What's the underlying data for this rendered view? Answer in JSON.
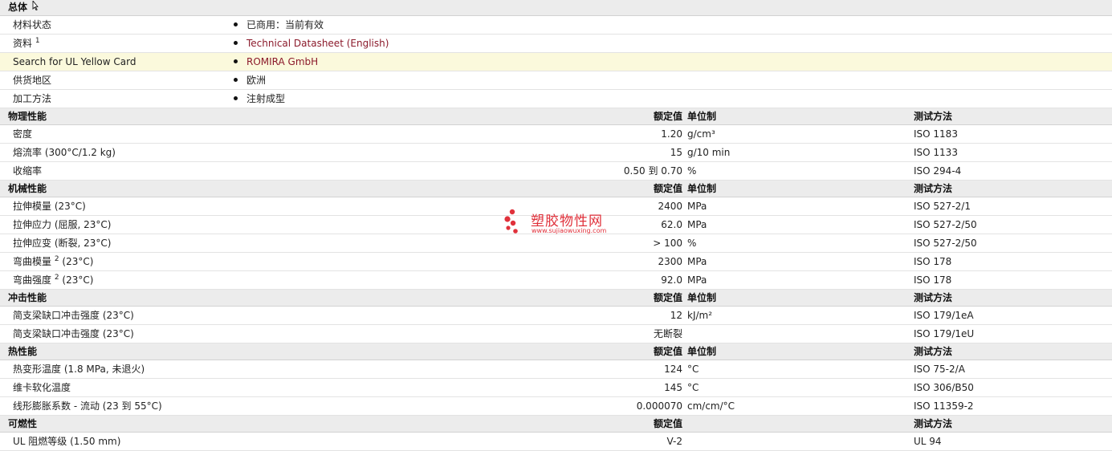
{
  "general": {
    "title": "总体",
    "rows": [
      {
        "label": "材料状态",
        "sup": "",
        "value": "已商用：当前有效",
        "link": false
      },
      {
        "label": "资料",
        "sup": "1",
        "value": "Technical Datasheet (English)",
        "link": true
      },
      {
        "label": "Search for UL Yellow Card",
        "sup": "",
        "value": "ROMIRA GmbH",
        "link": true,
        "highlight": true
      },
      {
        "label": "供货地区",
        "sup": "",
        "value": "欧洲",
        "link": false
      },
      {
        "label": "加工方法",
        "sup": "",
        "value": "注射成型",
        "link": false
      }
    ]
  },
  "headers": {
    "nominal": "额定值",
    "unit": "单位制",
    "method": "测试方法"
  },
  "sections": [
    {
      "title": "物理性能",
      "rows": [
        {
          "label": "密度",
          "sup": "",
          "cond": "",
          "value": "1.20",
          "unit": "g/cm³",
          "method": "ISO 1183"
        },
        {
          "label": "熔流率",
          "sup": "",
          "cond": " (300°C/1.2 kg)",
          "value": "15",
          "unit": "g/10 min",
          "method": "ISO 1133"
        },
        {
          "label": "收缩率",
          "sup": "",
          "cond": "",
          "value": "0.50 到  0.70",
          "unit": "%",
          "method": "ISO 294-4"
        }
      ]
    },
    {
      "title": "机械性能",
      "rows": [
        {
          "label": "拉伸模量",
          "sup": "",
          "cond": " (23°C)",
          "value": "2400",
          "unit": "MPa",
          "method": "ISO 527-2/1"
        },
        {
          "label": "拉伸应力",
          "sup": "",
          "cond": " (屈服, 23°C)",
          "value": "62.0",
          "unit": "MPa",
          "method": "ISO 527-2/50"
        },
        {
          "label": "拉伸应变",
          "sup": "",
          "cond": " (断裂, 23°C)",
          "value": "> 100",
          "unit": "%",
          "method": "ISO 527-2/50"
        },
        {
          "label": "弯曲模量",
          "sup": "2",
          "cond": " (23°C)",
          "value": "2300",
          "unit": "MPa",
          "method": "ISO 178"
        },
        {
          "label": "弯曲强度",
          "sup": "2",
          "cond": " (23°C)",
          "value": "92.0",
          "unit": "MPa",
          "method": "ISO 178"
        }
      ]
    },
    {
      "title": "冲击性能",
      "rows": [
        {
          "label": "简支梁缺口冲击强度",
          "sup": "",
          "cond": " (23°C)",
          "value": "12",
          "unit": "kJ/m²",
          "method": "ISO 179/1eA"
        },
        {
          "label": "简支梁缺口冲击强度",
          "sup": "",
          "cond": " (23°C)",
          "value": "无断裂",
          "unit": "",
          "method": "ISO 179/1eU"
        }
      ]
    },
    {
      "title": "热性能",
      "rows": [
        {
          "label": "热变形温度",
          "sup": "",
          "cond": " (1.8 MPa, 未退火)",
          "value": "124",
          "unit": "°C",
          "method": "ISO 75-2/A"
        },
        {
          "label": "维卡软化温度",
          "sup": "",
          "cond": "",
          "value": "145",
          "unit": "°C",
          "method": "ISO 306/B50"
        },
        {
          "label": "线形膨胀系数",
          "sup": "",
          "cond": " - 流动 (23 到  55°C)",
          "value": "0.000070",
          "unit": "cm/cm/°C",
          "method": "ISO 11359-2"
        }
      ]
    },
    {
      "title": "可燃性",
      "noUnitHeader": true,
      "rows": [
        {
          "label": "UL 阻燃等级",
          "sup": "",
          "cond": " (1.50 mm)",
          "value": "V-2",
          "unit": "",
          "method": "UL 94"
        }
      ]
    }
  ],
  "watermark": {
    "title": "塑胶物性网",
    "url": "www.sujiaowuxing.com"
  },
  "colors": {
    "link": "#8b1a2b",
    "section_bg": "#ececec",
    "highlight_bg": "#fbf9dc",
    "watermark": "#e0313b"
  }
}
